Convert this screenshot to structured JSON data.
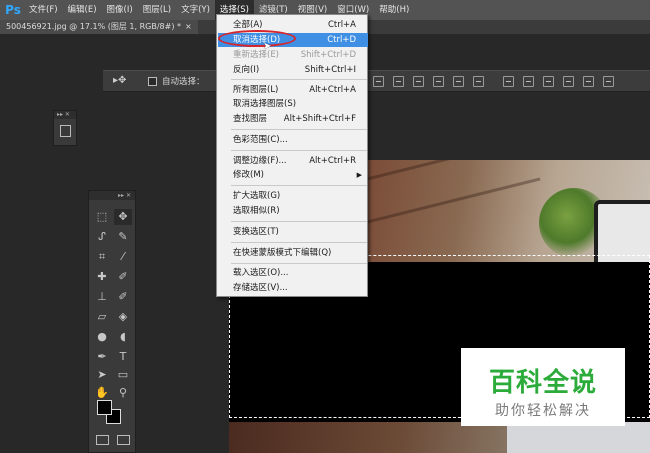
{
  "app": {
    "logo": "Ps"
  },
  "menubar": {
    "items": [
      "文件(F)",
      "编辑(E)",
      "图像(I)",
      "图层(L)",
      "文字(Y)",
      "选择(S)",
      "滤镜(T)",
      "视图(V)",
      "窗口(W)",
      "帮助(H)"
    ],
    "active_index": 5
  },
  "document_tab": {
    "title": "500456921.jpg @ 17.1% (图层 1, RGB/8#) *",
    "close": "×"
  },
  "options_bar": {
    "auto_select_label": "自动选择："
  },
  "select_menu": {
    "items": [
      {
        "label": "全部(A)",
        "shortcut": "Ctrl+A",
        "state": "normal"
      },
      {
        "label": "取消选择(D)",
        "shortcut": "Ctrl+D",
        "state": "highlighted"
      },
      {
        "label": "重新选择(E)",
        "shortcut": "Shift+Ctrl+D",
        "state": "disabled"
      },
      {
        "label": "反向(I)",
        "shortcut": "Shift+Ctrl+I",
        "state": "normal"
      },
      {
        "label": "所有图层(L)",
        "shortcut": "Alt+Ctrl+A",
        "state": "normal"
      },
      {
        "label": "取消选择图层(S)",
        "shortcut": "",
        "state": "normal"
      },
      {
        "label": "查找图层",
        "shortcut": "Alt+Shift+Ctrl+F",
        "state": "normal"
      },
      {
        "label": "色彩范围(C)...",
        "shortcut": "",
        "state": "normal"
      },
      {
        "label": "调整边缘(F)...",
        "shortcut": "Alt+Ctrl+R",
        "state": "normal"
      },
      {
        "label": "修改(M)",
        "shortcut": "",
        "state": "normal"
      },
      {
        "label": "扩大选取(G)",
        "shortcut": "",
        "state": "normal"
      },
      {
        "label": "选取相似(R)",
        "shortcut": "",
        "state": "normal"
      },
      {
        "label": "变换选区(T)",
        "shortcut": "",
        "state": "normal"
      },
      {
        "label": "在快速蒙版模式下编辑(Q)",
        "shortcut": "",
        "state": "normal"
      },
      {
        "label": "载入选区(O)...",
        "shortcut": "",
        "state": "normal"
      },
      {
        "label": "存储选区(V)...",
        "shortcut": "",
        "state": "normal"
      }
    ]
  },
  "toolbox": {
    "tools": [
      "rect-marquee-icon",
      "move-icon",
      "lasso-icon",
      "quick-select-icon",
      "crop-icon",
      "eyedropper-icon",
      "healing-icon",
      "brush-icon",
      "clone-stamp-icon",
      "history-brush-icon",
      "eraser-icon",
      "paint-bucket-icon",
      "blur-icon",
      "dodge-icon",
      "pen-icon",
      "type-icon",
      "path-select-icon",
      "shape-icon",
      "hand-icon",
      "zoom-icon"
    ],
    "foreground_color": "#000000",
    "background_color": "#000000"
  },
  "watermark": {
    "title": "百科全说",
    "subtitle": "助你轻松解决",
    "title_color": "#2bab3a"
  },
  "colors": {
    "menu_highlight": "#3f8fe4",
    "annotation_ellipse": "#d6262c",
    "ps_blue": "#31a8ff"
  }
}
